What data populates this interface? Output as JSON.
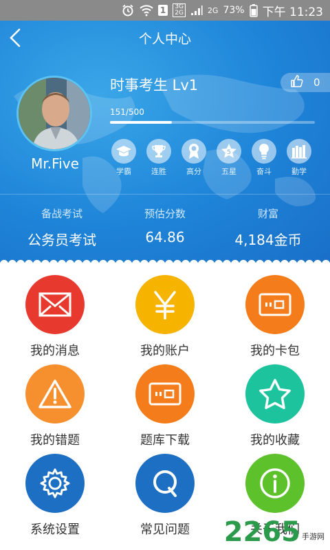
{
  "status_bar": {
    "sim_badge": "1",
    "net_top": "3G",
    "net_bottom": "2G",
    "net2": "2G",
    "battery": "73%",
    "time": "下午 11:23",
    "icons": [
      "alarm-icon",
      "wifi-icon",
      "signal-icon",
      "battery-icon"
    ]
  },
  "header": {
    "title": "个人中心",
    "back_icon": "chevron-left-icon"
  },
  "profile": {
    "username": "Mr.Five",
    "level_title": "时事考生 Lv1",
    "likes": "0",
    "progress_text": "151/500",
    "progress_fraction": 0.302,
    "badges": [
      {
        "label": "学霸",
        "icon": "graduation-cap-icon"
      },
      {
        "label": "连胜",
        "icon": "trophy-icon"
      },
      {
        "label": "高分",
        "icon": "medal-icon"
      },
      {
        "label": "五星",
        "icon": "star-icon"
      },
      {
        "label": "奋斗",
        "icon": "lightbulb-icon"
      },
      {
        "label": "勤学",
        "icon": "books-icon"
      }
    ]
  },
  "stats": [
    {
      "label": "备战考试",
      "value": "公务员考试"
    },
    {
      "label": "预估分数",
      "value": "64.86"
    },
    {
      "label": "财富",
      "value": "4,184金币"
    }
  ],
  "menu": [
    {
      "label": "我的消息",
      "icon": "envelope-icon",
      "color": "#e8392f"
    },
    {
      "label": "我的账户",
      "icon": "yen-icon",
      "color": "#f6b400"
    },
    {
      "label": "我的卡包",
      "icon": "card-icon",
      "color": "#f47c1b"
    },
    {
      "label": "我的错题",
      "icon": "warning-icon",
      "color": "#f68f2e"
    },
    {
      "label": "题库下载",
      "icon": "card-icon",
      "color": "#f47c1b"
    },
    {
      "label": "我的收藏",
      "icon": "star-outline-icon",
      "color": "#1cc39c"
    },
    {
      "label": "系统设置",
      "icon": "gear-icon",
      "color": "#1d6fc4"
    },
    {
      "label": "常见问题",
      "icon": "question-icon",
      "color": "#1d6fc4"
    },
    {
      "label": "关于我们",
      "icon": "info-icon",
      "color": "#5cc12a"
    }
  ],
  "watermark": {
    "number": "2265",
    "text": "手游网"
  },
  "colors": {
    "header_blue": "#1e84d8",
    "accent_light": "#5cc3f2"
  }
}
